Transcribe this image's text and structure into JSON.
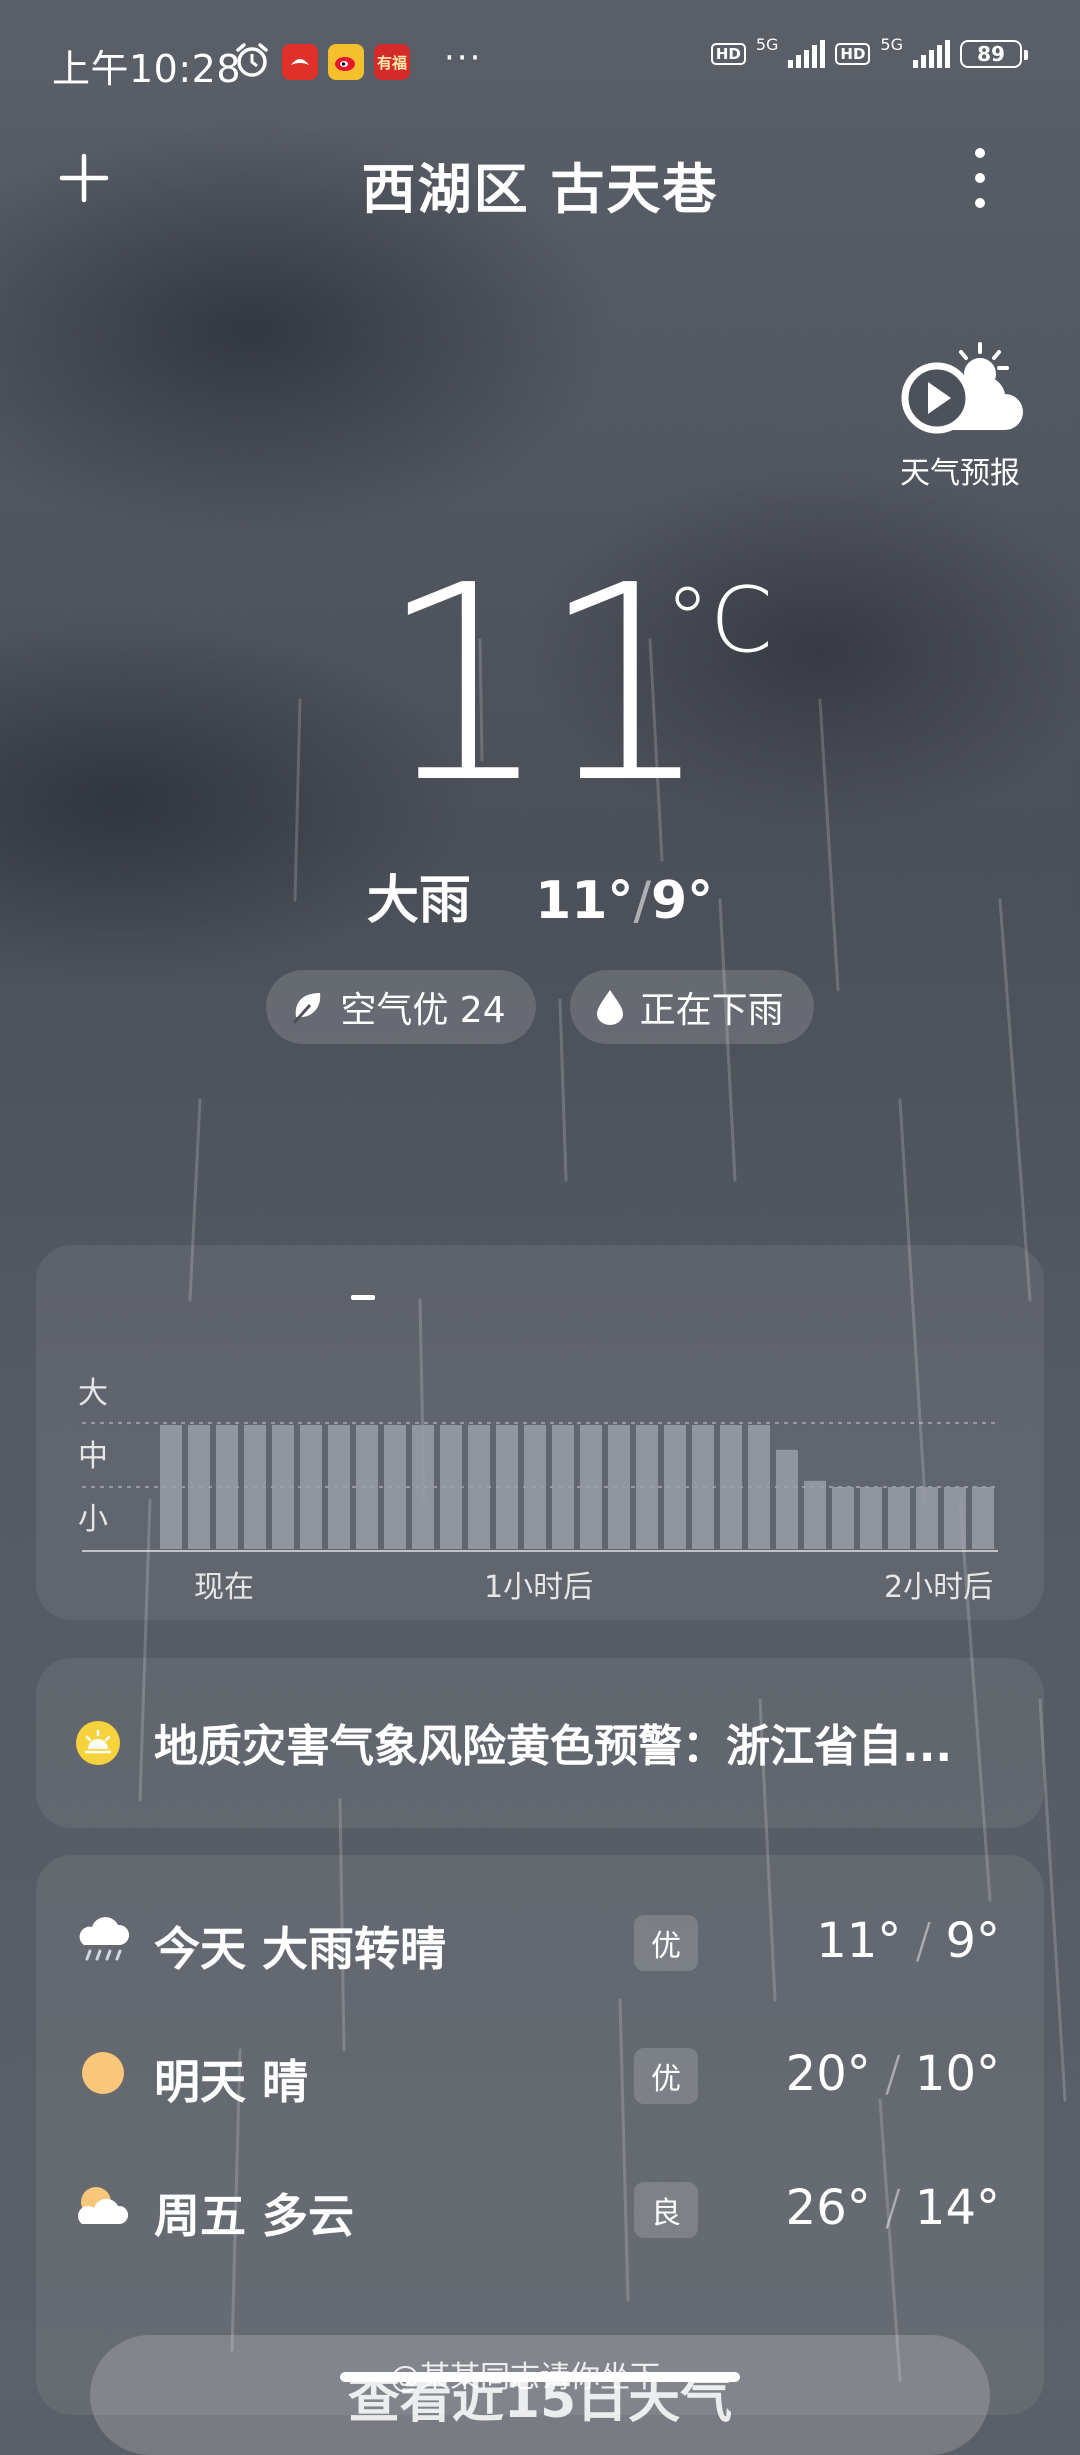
{
  "status_bar": {
    "time": "上午10:28",
    "notif_apps": [
      {
        "name": "red-app",
        "label": "",
        "color": "#e0302a"
      },
      {
        "name": "weibo",
        "label": "",
        "color": "#f5c02e"
      },
      {
        "name": "fu-app",
        "label": "有福",
        "color": "#d42a2a"
      }
    ],
    "more": "···",
    "hd1": "HD",
    "net1": "5G",
    "hd2": "HD",
    "net2": "5G",
    "battery": "89"
  },
  "header": {
    "add_icon": "plus-icon",
    "location": "西湖区 古天巷",
    "menu_icon": "more-vertical-icon"
  },
  "forecast_video": {
    "icon": "play-sun-cloud-icon",
    "label": "天气预报"
  },
  "current": {
    "temp": "11",
    "unit": "°C",
    "condition": "大雨",
    "high": "11°",
    "low": "9°",
    "slash": "/"
  },
  "pills": {
    "air": {
      "icon": "leaf-icon",
      "label": "空气优 24"
    },
    "rain": {
      "icon": "water-drop-icon",
      "label": "正在下雨"
    }
  },
  "precip_chart": {
    "y_labels": [
      "大",
      "中",
      "小"
    ],
    "x_labels": [
      "现在",
      "1小时后",
      "2小时后"
    ],
    "intensity_levels": [
      "小",
      "中",
      "大"
    ],
    "bar_fill_to_mid": [
      1,
      1,
      1,
      1,
      1,
      1,
      1,
      1,
      1,
      1,
      1,
      1,
      1,
      1,
      1,
      1,
      1,
      1,
      1,
      1,
      1,
      1,
      0.8,
      0.55,
      0.5,
      0.5,
      0.5,
      0.5,
      0.5,
      0.5
    ]
  },
  "warning": {
    "icon": "warning-sun-icon",
    "text": "地质灾害气象风险黄色预警：浙江省自..."
  },
  "daily": [
    {
      "icon": "rain-cloud-icon",
      "day": "今天",
      "cond": "大雨转晴",
      "aqi": "优",
      "high": "11°",
      "low": "9°"
    },
    {
      "icon": "sun-icon",
      "day": "明天",
      "cond": "晴",
      "aqi": "优",
      "high": "20°",
      "low": "10°"
    },
    {
      "icon": "partly-cloudy-icon",
      "day": "周五",
      "cond": "多云",
      "aqi": "良",
      "high": "26°",
      "low": "14°"
    }
  ],
  "bottom": {
    "button_label": "查看近15日天气",
    "watermark": "@某某同志请你坐下"
  },
  "colors": {
    "warning_yellow": "#f6d23c",
    "sun_orange": "#f8c77a",
    "bar_fill": "#9a9ea6"
  }
}
